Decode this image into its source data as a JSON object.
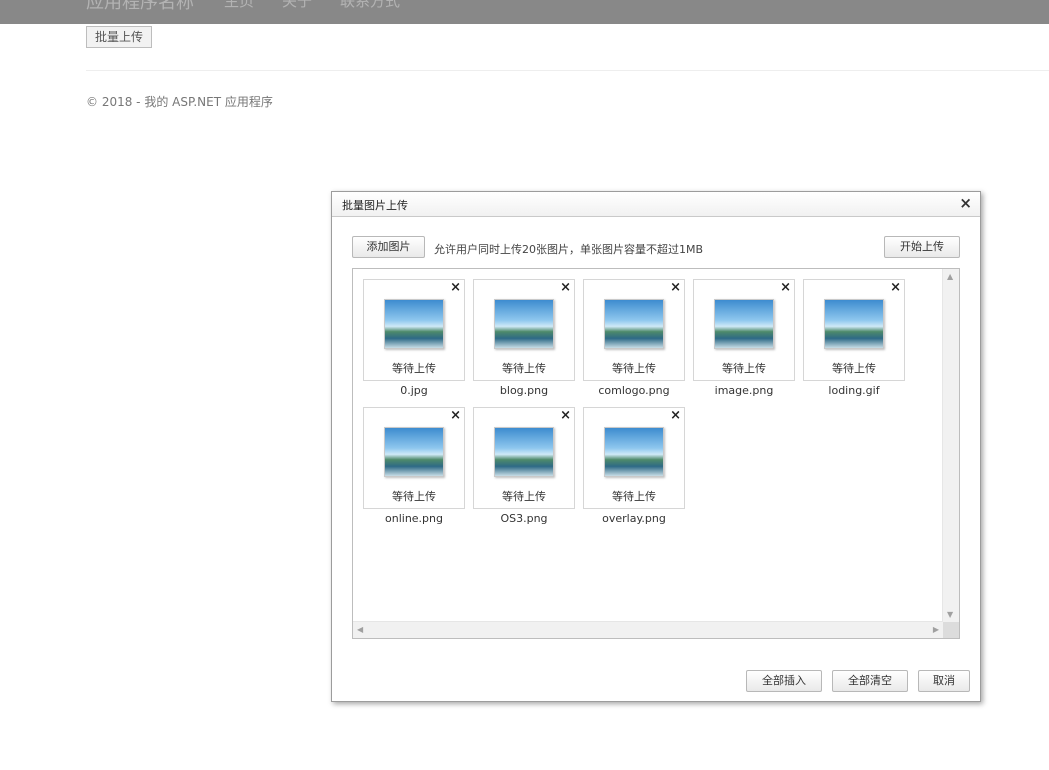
{
  "nav": {
    "brand": "应用程序名称",
    "links": [
      "主页",
      "关于",
      "联系方式"
    ]
  },
  "page": {
    "batch_upload": "批量上传",
    "footer": "© 2018 - 我的 ASP.NET 应用程序"
  },
  "dialog": {
    "title": "批量图片上传",
    "close": "×",
    "add_image": "添加图片",
    "hint": "允许用户同时上传20张图片，单张图片容量不超过1MB",
    "start_upload": "开始上传",
    "insert_all": "全部插入",
    "clear_all": "全部清空",
    "cancel": "取消",
    "files": [
      {
        "name": "0.jpg",
        "status": "等待上传"
      },
      {
        "name": "blog.png",
        "status": "等待上传"
      },
      {
        "name": "comlogo.png",
        "status": "等待上传"
      },
      {
        "name": "image.png",
        "status": "等待上传"
      },
      {
        "name": "loding.gif",
        "status": "等待上传"
      },
      {
        "name": "online.png",
        "status": "等待上传"
      },
      {
        "name": "OS3.png",
        "status": "等待上传"
      },
      {
        "name": "overlay.png",
        "status": "等待上传"
      }
    ],
    "delete_glyph": "×"
  }
}
